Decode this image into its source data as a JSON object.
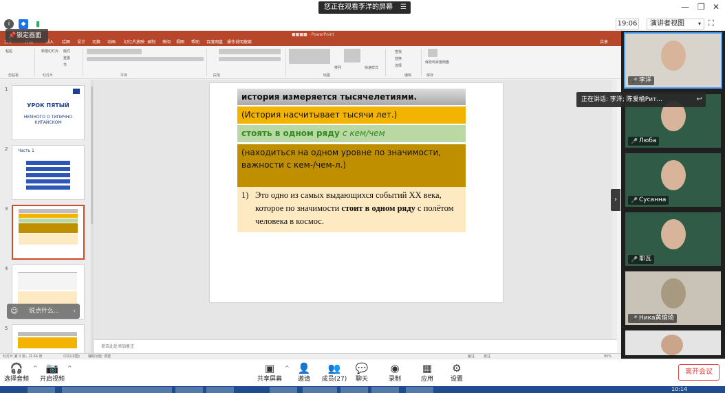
{
  "meeting": {
    "viewing_banner": "您正在观看李洋的屏幕",
    "clock": "19:06",
    "presenter_view": "演讲者视图",
    "speaking_now": "正在讲话: 李洋; 陈爱榆Рит..."
  },
  "ppt": {
    "lock_label": "锁定画面",
    "notes_placeholder": "单击此处添加备注",
    "tabs": [
      "文件",
      "开始",
      "插入",
      "绘图",
      "设计",
      "切换",
      "动画",
      "幻灯片放映",
      "录制",
      "审阅",
      "视图",
      "帮助",
      "百度网盘",
      "操作说明搜索"
    ],
    "share_label": "共享",
    "ribbon_groups": [
      "剪贴板",
      "幻灯片",
      "字体",
      "段落",
      "绘图",
      "编辑",
      "保存"
    ],
    "ribbon_small": [
      "粘贴",
      "新建幻灯片",
      "版式",
      "重置",
      "节",
      "排列",
      "快速样式",
      "查找",
      "替换",
      "选择",
      "保存到百度网盘"
    ],
    "status_left": "幻灯片 第 3 张，共 64 张",
    "status_lang": "中文(中国)",
    "status_access": "辅助功能: 调查",
    "status_zoom": "95%",
    "status_notes": "备注",
    "status_comments": "批注"
  },
  "slide": {
    "line1": "история измеряется тысячелетиями.",
    "line2": "(История  насчитывает   тысячи лет.)",
    "line3_bold": "стоять в одном ряду ",
    "line3_italic": "с кем/чем",
    "line4": "(находиться на одном уровне по значимости, важности с кем-/чем-л.)",
    "ex_num": "1)",
    "ex_text_1": "Это одно из самых выдающихся событий XX века, которое по значимости ",
    "ex_bold": "стоит в одном ряду",
    "ex_text_2": " с полётом человека в космос."
  },
  "thumbs": [
    {
      "num": "1",
      "title": "УРОК ПЯТЫЙ",
      "sub": "НЕМНОГО О ТИПИЧНО КИТАЙСКОМ"
    },
    {
      "num": "2",
      "title": "Часть 1"
    },
    {
      "num": "3"
    },
    {
      "num": "4"
    },
    {
      "num": "5"
    }
  ],
  "chat": {
    "placeholder": "说点什么..."
  },
  "participants": [
    {
      "name": "李洋"
    },
    {
      "name": "Люба"
    },
    {
      "name": "Сусанна"
    },
    {
      "name": "耶瓦"
    },
    {
      "name": "Ника黄瑜琦"
    }
  ],
  "toolbar": {
    "audio": "选择音频",
    "video": "开启视频",
    "share": "共享屏幕",
    "invite": "邀请",
    "members": "成员(27)",
    "chat": "聊天",
    "record": "录制",
    "apps": "应用",
    "settings": "设置",
    "leave": "离开会议"
  },
  "taskbar": {
    "time": "10:14"
  },
  "colors": {
    "ppt_accent": "#b7472a",
    "leave": "#e04444",
    "box_orange": "#f2b400",
    "box_gold": "#bf8f00",
    "box_green": "#b9d8a4"
  }
}
